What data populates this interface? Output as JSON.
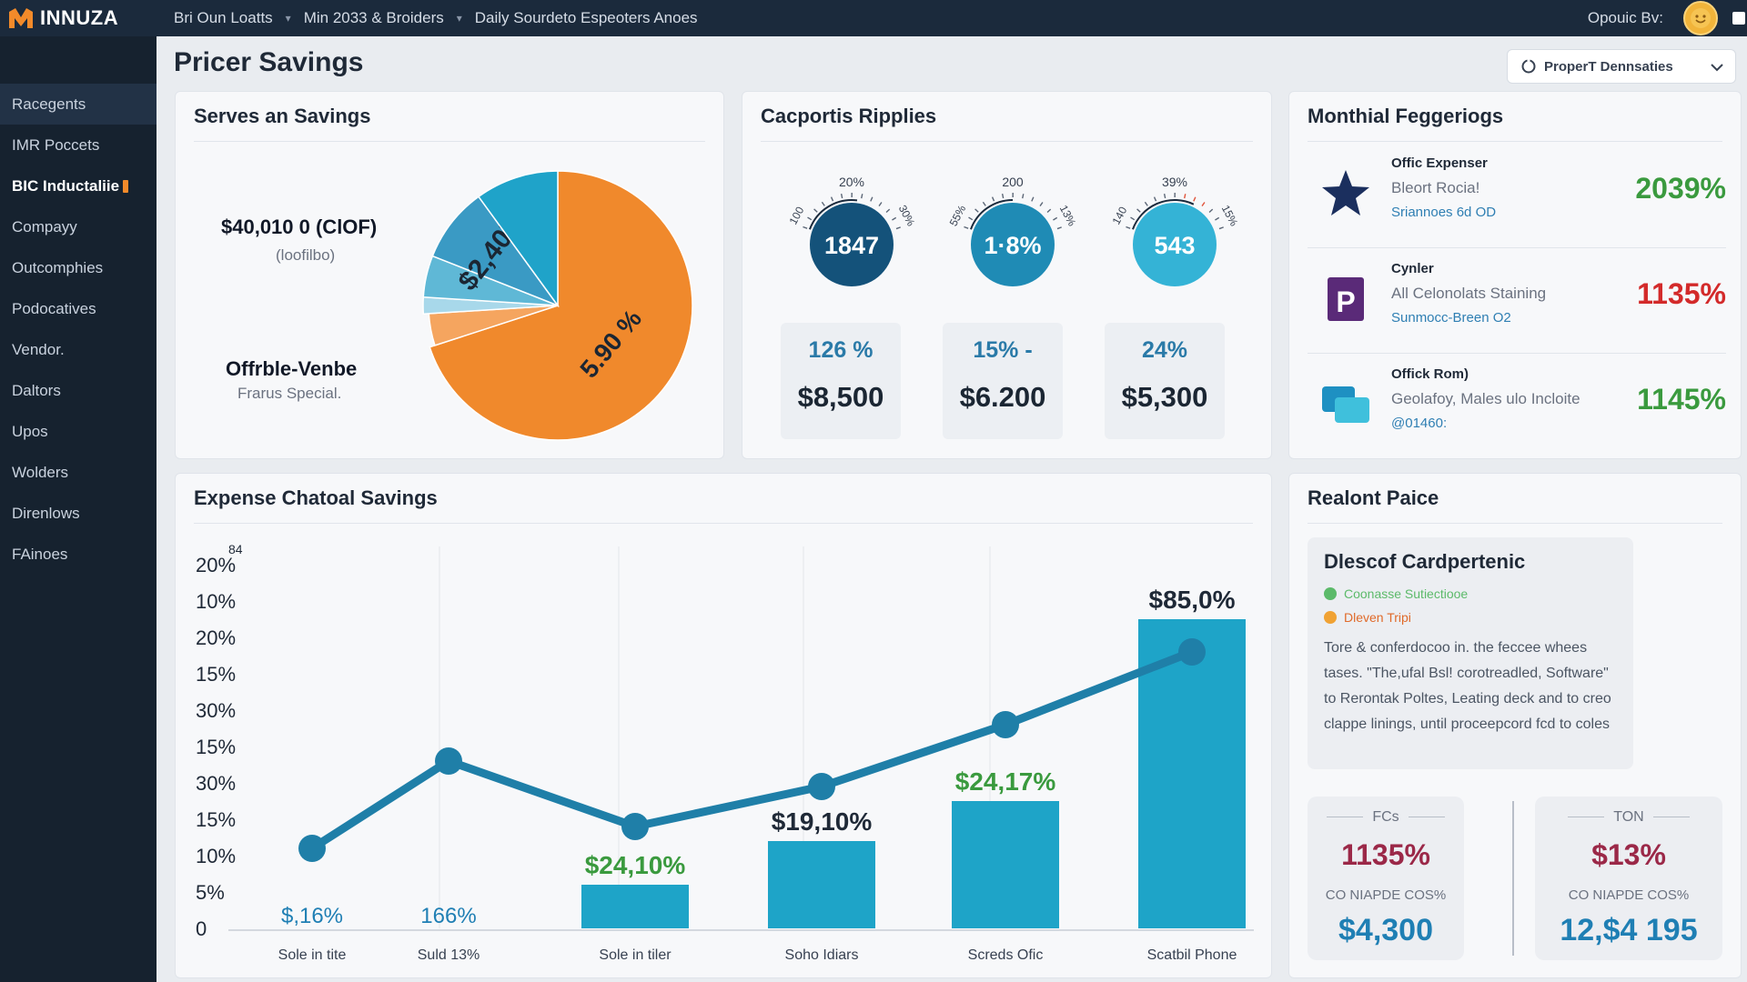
{
  "app": {
    "brand": "INNUZA"
  },
  "breadcrumbs": [
    "Bri Oun Loatts",
    "Min 2033 & Broiders",
    "Daily Sourdeto Espeoters Anoes"
  ],
  "topbar": {
    "user_label": "Opouic Bv:"
  },
  "sidebar": {
    "items": [
      {
        "label": "Racegents"
      },
      {
        "label": "IMR Poccets"
      },
      {
        "label": "BIC Inductaliie"
      },
      {
        "label": "Compayy"
      },
      {
        "label": "Outcomphies"
      },
      {
        "label": "Podocatives"
      },
      {
        "label": "Vendor."
      },
      {
        "label": "Daltors"
      },
      {
        "label": "Upos"
      },
      {
        "label": "Wolders"
      },
      {
        "label": "Direnlows"
      },
      {
        "label": "FAinoes"
      }
    ]
  },
  "page": {
    "title": "Pricer Savings",
    "dropdown_label": "ProperT Dennsaties"
  },
  "savings_card": {
    "title": "Serves an Savings",
    "amount": "$40,010 0 (ClOF)",
    "amount_sub": "(loofilbo)",
    "vendor": "Offrble-Venbe",
    "vendor_sub": "Frarus Special.",
    "pie": {
      "slices": [
        {
          "label": "5.90 %",
          "value": 0.7,
          "color": "#f0892c"
        },
        {
          "label": "",
          "value": 0.04,
          "color": "#f5a55f"
        },
        {
          "label": "",
          "value": 0.02,
          "color": "#a8d8ea"
        },
        {
          "label": "",
          "value": 0.05,
          "color": "#5fb8d6"
        },
        {
          "label": "$2,40T",
          "value": 0.09,
          "color": "#3a9ac4"
        },
        {
          "label": "",
          "value": 0.1,
          "color": "#1fa3c9"
        }
      ]
    }
  },
  "capacity_card": {
    "title": "Cacportis Ripplies",
    "gauges": [
      {
        "value": "1847",
        "top_label": "20%",
        "left_label": "100",
        "right_label": "30%",
        "color": "#14527a",
        "arc_color": "#1b2a3c",
        "level": 0.55
      },
      {
        "value": "1·8%",
        "top_label": "200",
        "left_label": "55%",
        "right_label": "13%",
        "color": "#1f8bb5",
        "arc_color": "#1b2a3c",
        "level": 0.5
      },
      {
        "value": "543",
        "top_label": "39%",
        "left_label": "140",
        "right_label": "15%",
        "color": "#34b3d6",
        "arc_color": "#e0533a",
        "level": 0.68
      }
    ],
    "stats": [
      {
        "pct": "126 %",
        "amount": "$8,500"
      },
      {
        "pct": "15% -",
        "amount": "$6.200"
      },
      {
        "pct": "24%",
        "amount": "$5,300"
      }
    ]
  },
  "monthly_card": {
    "title": "Monthial Feggeriogs",
    "rows": [
      {
        "icon": "star-icon",
        "title": "Offic Expenser",
        "line": "Bleort Rocia!",
        "link": "Sriannoes 6d OD",
        "value": "2039%",
        "value_color": "#3a9a3e"
      },
      {
        "icon": "letter-p-icon",
        "title": "Cynler",
        "line": "All Celonolats Staining",
        "link": "Sunmocc-Breen O2",
        "value": "1135%",
        "value_color": "#d32a2a"
      },
      {
        "icon": "chat-icon",
        "title": "Offick Rom)",
        "line": "Geolafoy, Males ulo Incloite",
        "link": "@01460:",
        "value": "1145%",
        "value_color": "#3a9a3e"
      }
    ]
  },
  "chart_card": {
    "title": "Expense Chatoal Savings"
  },
  "chart_data": {
    "type": "bar",
    "title": "Expense Chatoal Savings",
    "y_tick_labels": [
      "0",
      "5%",
      "10%",
      "15%",
      "30%",
      "15%",
      "30%",
      "15%",
      "20%",
      "10%",
      "20%"
    ],
    "y_top_suffix": "84",
    "categories": [
      "Sole in tite",
      "Suld 13%",
      "Sole in tiler",
      "Soho Idiars",
      "Screds Ofic",
      "Scatbil Phone"
    ],
    "bar_values": [
      0,
      0,
      1.2,
      2.4,
      3.5,
      8.5
    ],
    "bar_labels": [
      "$,16%",
      "166%",
      "$24,10%",
      "$19,10%",
      "$24,17%",
      "$85,0%"
    ],
    "bar_label_colors": [
      "#1f7fb4",
      "#1f7fb4",
      "#3a9a3e",
      "#1f2937",
      "#3a9a3e",
      "#1f2937"
    ],
    "line_values": [
      2.2,
      4.6,
      2.8,
      3.9,
      5.6,
      7.6
    ],
    "ylim": [
      0,
      10
    ],
    "bar_color": "#1ea4c8",
    "line_color": "#1f7fa8"
  },
  "recent_card": {
    "title": "Realont Paice",
    "box_title": "Dlescof Cardpertenic",
    "legend": [
      {
        "label": "Coonasse Sutiectiooe",
        "color": "#5cba6a"
      },
      {
        "label": "Dleven Tripi",
        "color": "#f0a234"
      }
    ],
    "text": "Tore & conferdocoo in. the feccee whees tases. \"The,ufal Bsl! corotreadled, Software\" to Rerontak Poltes, Leating deck and to creo clappe linings, until proceepcord fcd to coles",
    "stats": [
      {
        "label": "FCs",
        "pct": "1135%",
        "sub": "CO NIAPDE COS%",
        "amount": "$4,300"
      },
      {
        "label": "TON",
        "pct": "$13%",
        "sub": "CO NIAPDE COS%",
        "amount": "12,$4 195"
      }
    ]
  }
}
